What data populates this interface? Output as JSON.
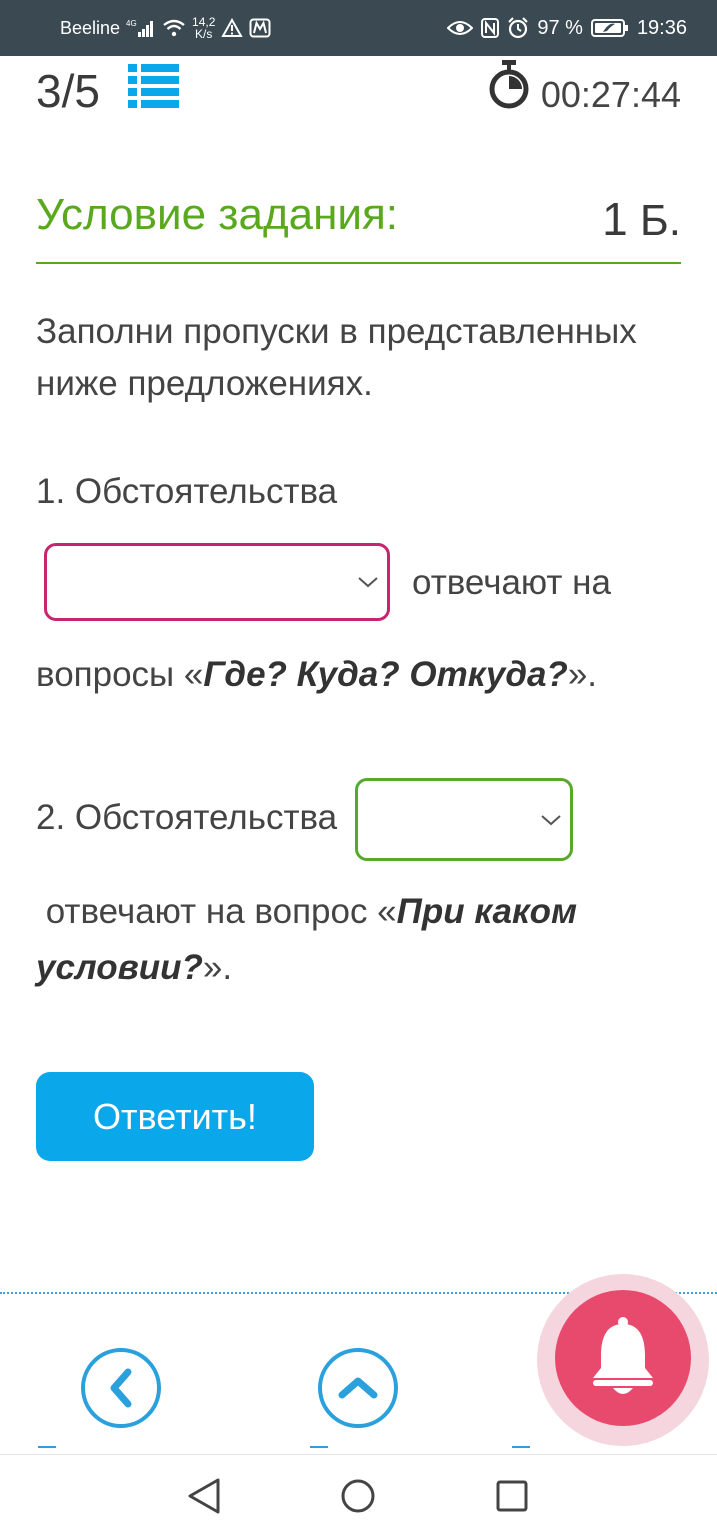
{
  "status_bar": {
    "carrier": "Beeline",
    "network": "4G",
    "speed_value": "14,2",
    "speed_unit": "K/s",
    "battery": "97 %",
    "time": "19:36",
    "icons": [
      "signal-icon",
      "wifi-icon",
      "warning-icon",
      "metro-icon",
      "eye-icon",
      "nfc-icon",
      "alarm-icon",
      "battery-icon"
    ]
  },
  "header": {
    "progress": "3/5",
    "timer": "00:27:44"
  },
  "task": {
    "condition_title": "Условие задания:",
    "points_value": "1",
    "points_unit": "Б.",
    "instruction": "Заполни пропуски в представленных ниже предложениях."
  },
  "question1": {
    "label": "1. Обстоятельства",
    "after_select": "отвечают на",
    "line2_prefix": "вопросы «",
    "line2_emphasis": "Где? Куда? Откуда?",
    "line2_suffix": "».",
    "select_value": "",
    "border_color": "#c8246f"
  },
  "question2": {
    "label": "2. Обстоятельства",
    "text_prefix": " отвечают на вопрос «",
    "text_emphasis": "При каком условии?",
    "text_suffix": "».",
    "select_value": "",
    "border_color": "#56a92a"
  },
  "actions": {
    "answer_label": "Ответить!"
  },
  "colors": {
    "accent_green": "#5aa81e",
    "button_blue": "#0aa8ea",
    "bell_pink": "#e84a6e"
  }
}
